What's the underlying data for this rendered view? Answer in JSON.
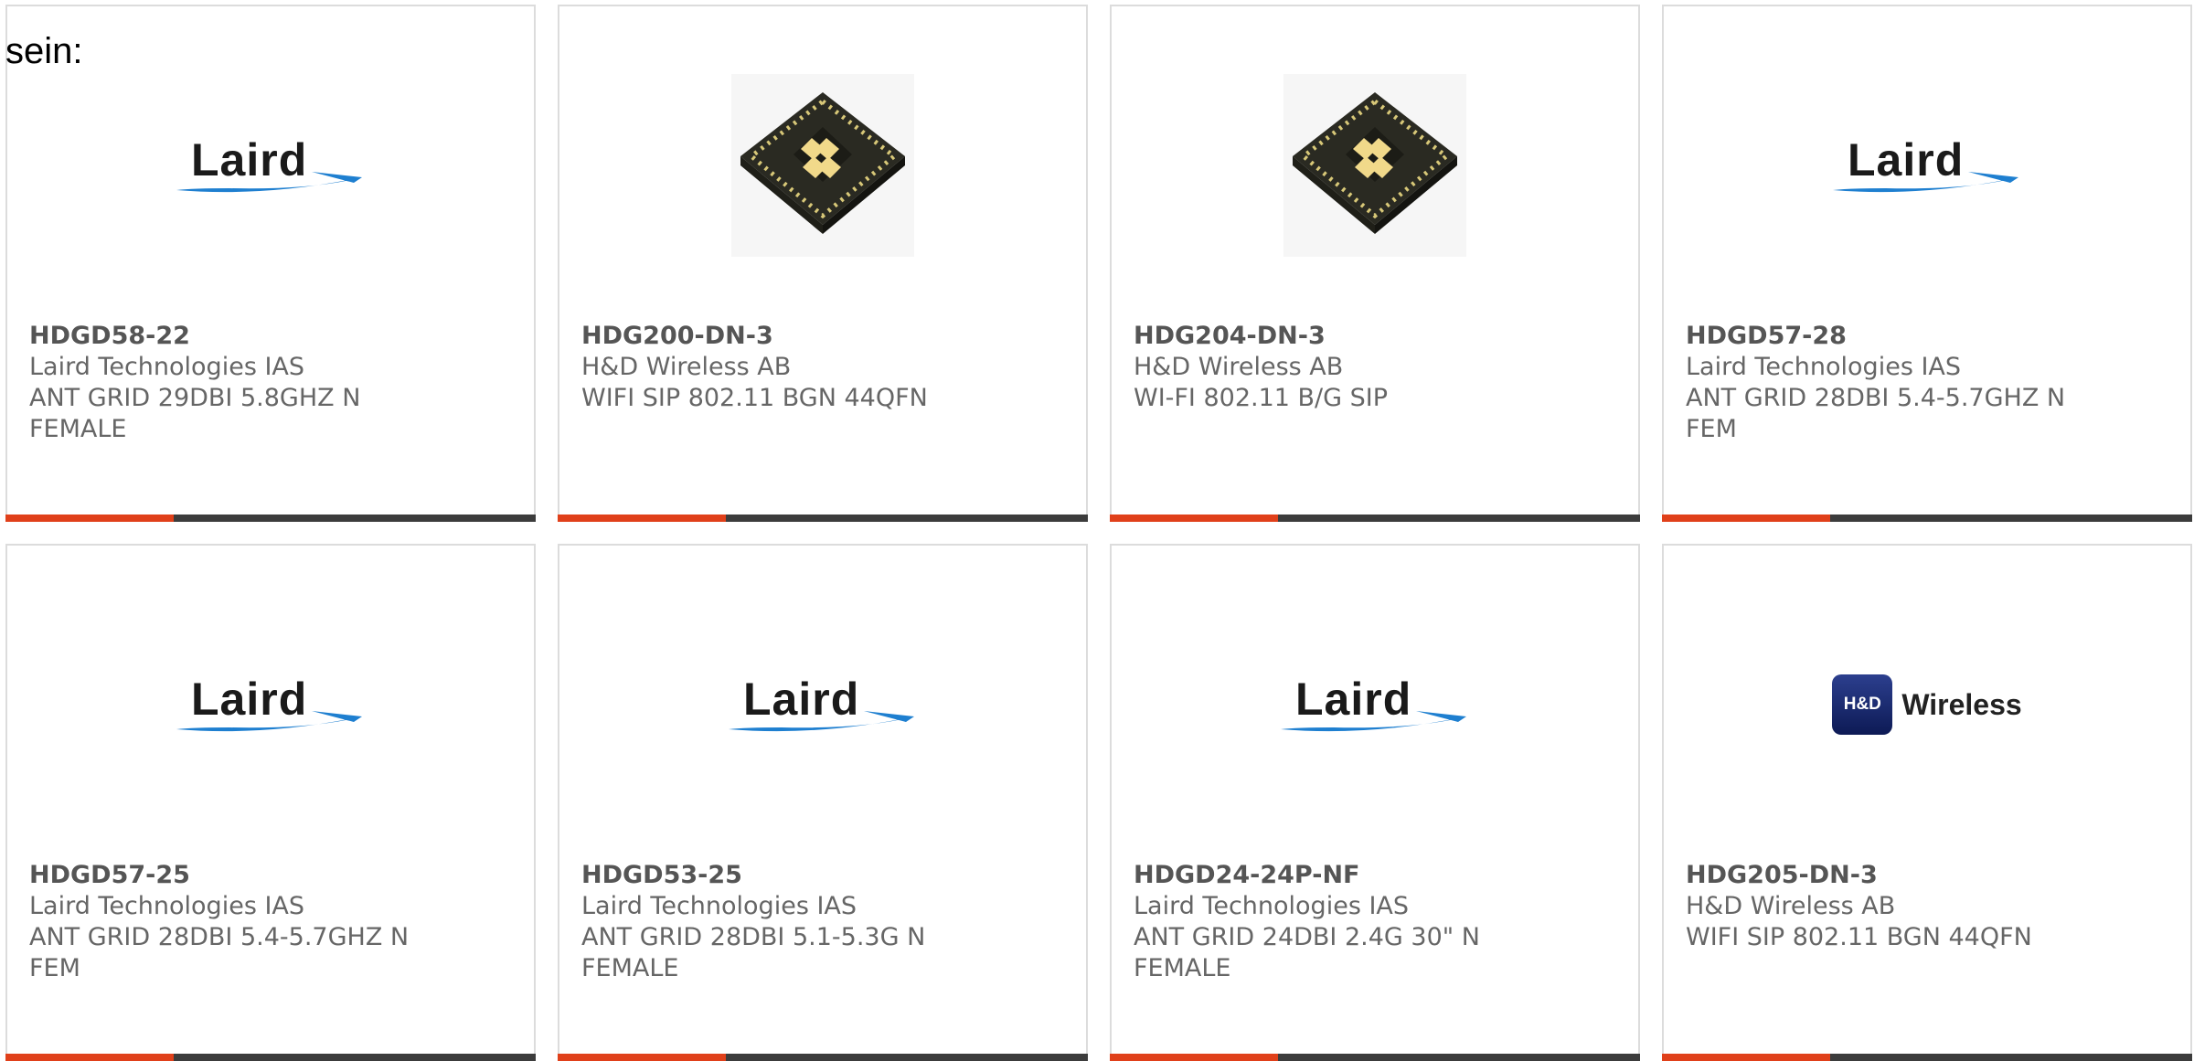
{
  "intro_text": "sein:",
  "colors": {
    "accent": "#e0401a",
    "bar_dark": "#3c3c3c",
    "text": "#666666",
    "card_border": "#dcdcdc"
  },
  "products": [
    {
      "part": "HDGD58-22",
      "maker": "Laird Technologies IAS",
      "desc": "ANT GRID 29DBI 5.8GHZ N FEMALE",
      "image": "laird-logo"
    },
    {
      "part": "HDG200-DN-3",
      "maker": "H&D Wireless AB",
      "desc": "WIFI SIP 802.11 BGN 44QFN",
      "image": "qfn-chip"
    },
    {
      "part": "HDG204-DN-3",
      "maker": "H&D Wireless AB",
      "desc": "WI-FI 802.11 B/G SIP",
      "image": "qfn-chip"
    },
    {
      "part": "HDGD57-28",
      "maker": "Laird Technologies IAS",
      "desc": "ANT GRID 28DBI 5.4-5.7GHZ N FEM",
      "image": "laird-logo"
    },
    {
      "part": "HDGD57-25",
      "maker": "Laird Technologies IAS",
      "desc": "ANT GRID 28DBI 5.4-5.7GHZ N FEM",
      "image": "laird-logo"
    },
    {
      "part": "HDGD53-25",
      "maker": "Laird Technologies IAS",
      "desc": "ANT GRID 28DBI 5.1-5.3G N FEMALE",
      "image": "laird-logo"
    },
    {
      "part": "HDGD24-24P-NF",
      "maker": "Laird Technologies IAS",
      "desc": "ANT GRID 24DBI 2.4G 30\" N FEMALE",
      "image": "laird-logo"
    },
    {
      "part": "HDG205-DN-3",
      "maker": "H&D Wireless AB",
      "desc": "WIFI SIP 802.11 BGN 44QFN",
      "image": "hd-wireless-logo"
    }
  ],
  "logos": {
    "laird_word": "Laird",
    "hd_box": "H&D",
    "hd_word": "Wireless"
  }
}
